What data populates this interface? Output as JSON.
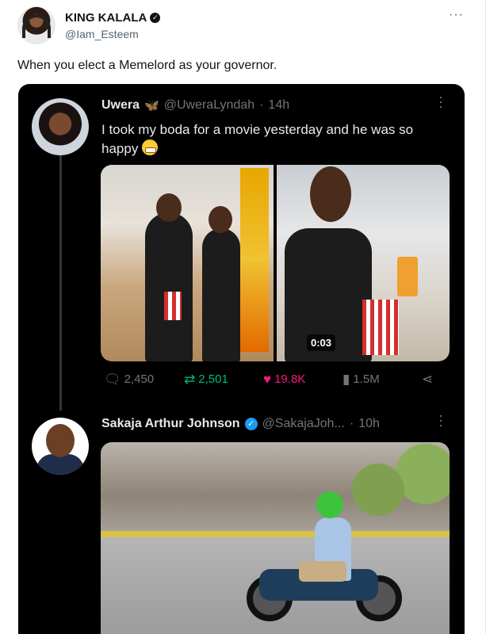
{
  "tweet": {
    "author_name": "KING KALALA",
    "author_handle": "@Iam_Esteem",
    "text": "When you elect a Memelord as your governor.",
    "more_icon": "more-horizontal-icon"
  },
  "quote1": {
    "name": "Uwera",
    "handle": "@UweraLyndah",
    "time": "14h",
    "text": "I took my boda for a movie yesterday and he was so happy",
    "emoji": "grinning-face-emoji",
    "video_duration": "0:03",
    "stats": {
      "replies": "2,450",
      "retweets": "2,501",
      "likes": "19.8K",
      "views": "1.5M"
    }
  },
  "quote2": {
    "name": "Sakaja Arthur Johnson",
    "handle": "@SakajaJoh...",
    "time": "10h"
  },
  "colors": {
    "like": "#f91880",
    "retweet": "#00ba7c",
    "verified": "#1d9bf0",
    "embed_bg": "#000000"
  }
}
